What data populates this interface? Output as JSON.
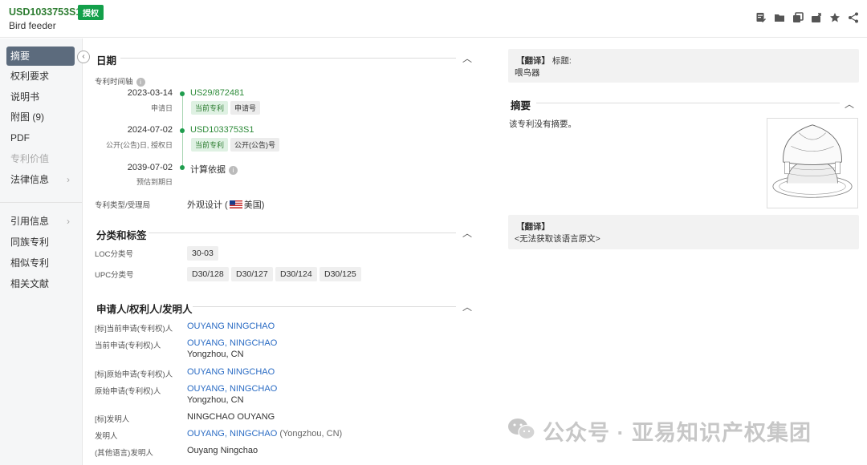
{
  "header": {
    "patent_number": "USD1033753S1",
    "status_badge": "授权",
    "title": "Bird feeder",
    "actions": [
      "edit-note-icon",
      "folder-icon",
      "copy-icon",
      "export-icon",
      "star-icon",
      "share-icon"
    ]
  },
  "sidebar": {
    "items": [
      {
        "label": "摘要",
        "state": "active"
      },
      {
        "label": "权利要求",
        "state": "normal"
      },
      {
        "label": "说明书",
        "state": "normal"
      },
      {
        "label": "附图 (9)",
        "state": "normal"
      },
      {
        "label": "PDF",
        "state": "normal"
      },
      {
        "label": "专利价值",
        "state": "disabled"
      },
      {
        "label": "法律信息",
        "state": "normal",
        "arrow": "›"
      },
      {
        "label": "引用信息",
        "state": "normal",
        "arrow": "›"
      },
      {
        "label": "同族专利",
        "state": "normal"
      },
      {
        "label": "相似专利",
        "state": "normal"
      },
      {
        "label": "相关文献",
        "state": "normal"
      }
    ],
    "collapse_glyph": "‹"
  },
  "date_section": {
    "title": "日期",
    "timeline_label": "专利时间轴",
    "events": [
      {
        "date": "2023-03-14",
        "sub": "申请日",
        "number": "US29/872481",
        "tags": [
          "当前专利",
          "申请号"
        ]
      },
      {
        "date": "2024-07-02",
        "sub": "公开(公告)日, 授权日",
        "number": "USD1033753S1",
        "tags": [
          "当前专利",
          "公开(公告)号"
        ]
      },
      {
        "date": "2039-07-02",
        "sub": "预估到期日",
        "number": "计算依据",
        "tags": []
      }
    ],
    "type_label": "专利类型/受理局",
    "type_value": "外观设计 (",
    "country": "美国",
    "type_close": ")"
  },
  "class_section": {
    "title": "分类和标签",
    "loc_label": "LOC分类号",
    "loc_values": [
      "30-03"
    ],
    "upc_label": "UPC分类号",
    "upc_values": [
      "D30/128",
      "D30/127",
      "D30/124",
      "D30/125"
    ]
  },
  "people_section": {
    "title": "申请人/权利人/发明人",
    "rows": [
      {
        "label": "[标]当前申请(专利权)人",
        "value": "OUYANG NINGCHAO",
        "extra": "",
        "link": true
      },
      {
        "label": "当前申请(专利权)人",
        "value": "OUYANG, NINGCHAO",
        "extra": "Yongzhou, CN",
        "link": true
      },
      {
        "label": "[标]原始申请(专利权)人",
        "value": "OUYANG NINGCHAO",
        "extra": "",
        "link": true
      },
      {
        "label": "原始申请(专利权)人",
        "value": "OUYANG, NINGCHAO",
        "extra": "Yongzhou, CN",
        "link": true
      },
      {
        "label": "[标]发明人",
        "value": "NINGCHAO OUYANG",
        "extra": "",
        "link": false
      },
      {
        "label": "发明人",
        "value": "OUYANG, NINGCHAO",
        "extra": " (Yongzhou, CN)",
        "link": true
      },
      {
        "label": "(其他语言)发明人",
        "value": "Ouyang Ningchao",
        "extra": "",
        "link": false
      }
    ]
  },
  "right": {
    "translate_tag": "【翻译】",
    "title_label": "标题:",
    "title_value": "喂鸟器",
    "abstract_title": "摘要",
    "abstract_text": "该专利没有摘要。",
    "translate_tag2": "【翻译】",
    "no_source": "<无法获取该语言原文>"
  },
  "watermark": {
    "text": "公众号 · 亚易知识产权集团"
  }
}
